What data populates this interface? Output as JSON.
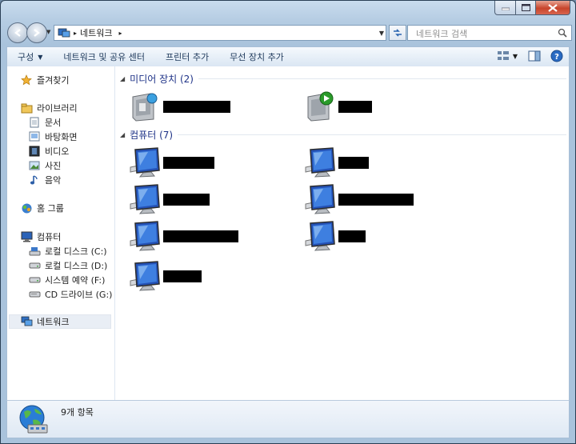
{
  "window": {
    "title": ""
  },
  "address": {
    "segments": [
      "네트워크"
    ],
    "separator": "▸"
  },
  "search": {
    "placeholder": "네트워크 검색"
  },
  "toolbar": {
    "organize": "구성",
    "network_sharing": "네트워크 및 공유 센터",
    "add_printer": "프린터 추가",
    "add_wireless": "무선 장치 추가"
  },
  "nav": {
    "favorites": "즐겨찾기",
    "libraries": "라이브러리",
    "documents": "문서",
    "desktop": "바탕화면",
    "videos": "비디오",
    "pictures": "사진",
    "music": "음악",
    "homegroup": "홈 그룹",
    "computer": "컴퓨터",
    "drive_c": "로컬 디스크 (C:)",
    "drive_d": "로컬 디스크 (D:)",
    "drive_f": "시스템 예약 (F:)",
    "drive_g": "CD 드라이브 (G:)",
    "network": "네트워크"
  },
  "groups": {
    "media": "미디어 장치 (2)",
    "computers": "컴퓨터 (7)"
  },
  "status": {
    "count": "9개 항목"
  },
  "colors": {
    "accent": "#1e3287",
    "window_frame": "#b6cde3"
  },
  "icons": [
    "back-icon",
    "forward-icon",
    "network-icon",
    "refresh-icon",
    "search-icon",
    "views-icon",
    "preview-pane-icon",
    "help-icon",
    "star-icon",
    "library-icon",
    "document-icon",
    "desktop-icon",
    "video-icon",
    "picture-icon",
    "music-icon",
    "homegroup-icon",
    "computer-icon",
    "drive-icon",
    "cd-drive-icon",
    "media-device-icon",
    "globe-icon"
  ]
}
